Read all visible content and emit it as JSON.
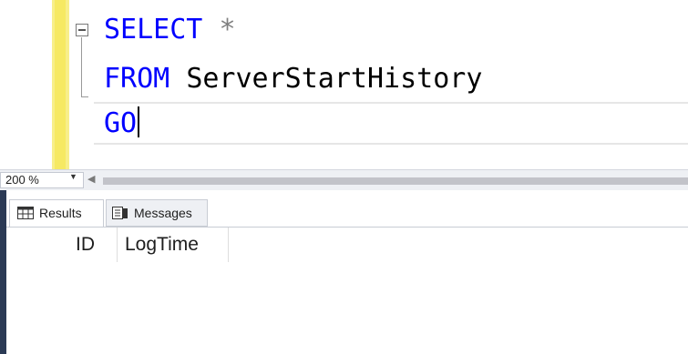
{
  "editor": {
    "line1_keyword": "SELECT",
    "line1_rest": "*",
    "line2_keyword": "FROM",
    "line2_ident": "ServerStartHistory",
    "line3_keyword": "GO"
  },
  "zoom": {
    "value": "200 %"
  },
  "tabs": [
    {
      "label": "Results",
      "icon": "grid-icon",
      "selected": true
    },
    {
      "label": "Messages",
      "icon": "messages-icon",
      "selected": false
    }
  ],
  "results": {
    "columns": [
      "ID",
      "LogTime"
    ],
    "rows": []
  },
  "colors": {
    "keyword": "#0000ff",
    "change_bar": "#f6e963",
    "frame": "#2b3a55"
  }
}
